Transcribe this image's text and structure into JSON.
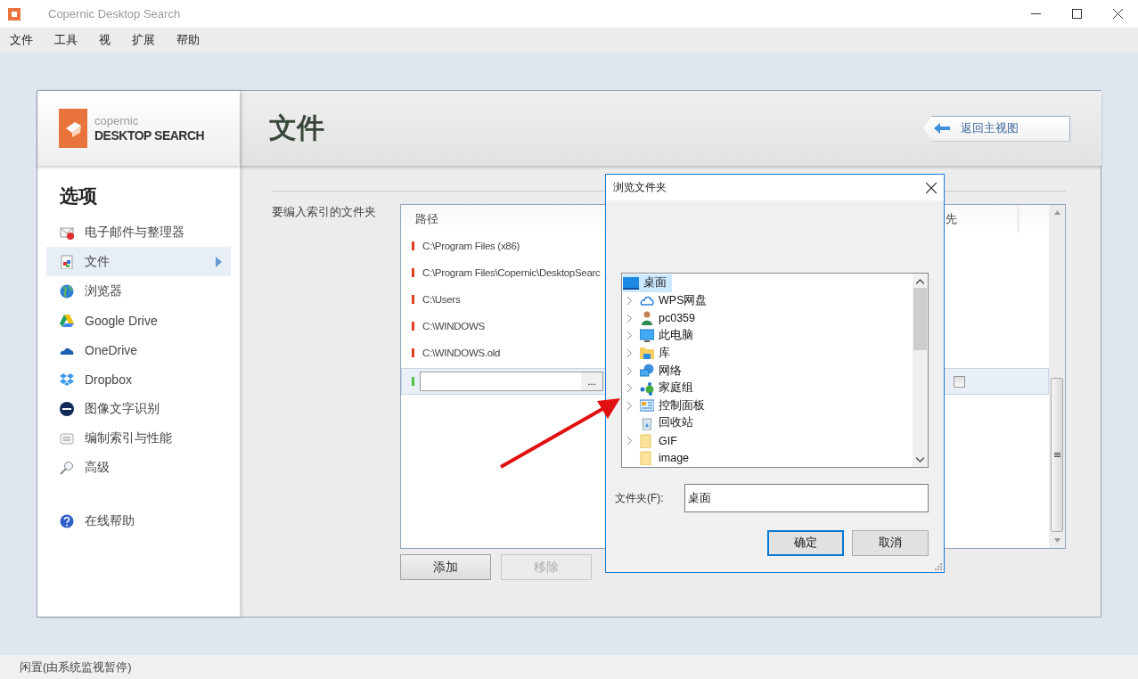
{
  "window": {
    "title": "Copernic Desktop Search"
  },
  "menu": [
    "文件",
    "工具",
    "视",
    "扩展",
    "帮助"
  ],
  "logo": {
    "brand": "copernic",
    "product": "DESKTOP SEARCH"
  },
  "sidebar": {
    "heading": "选项",
    "items": [
      {
        "label": "电子邮件与整理器",
        "selected": false
      },
      {
        "label": "文件",
        "selected": true
      },
      {
        "label": "浏览器",
        "selected": false
      },
      {
        "label": "Google Drive",
        "selected": false
      },
      {
        "label": "OneDrive",
        "selected": false
      },
      {
        "label": "Dropbox",
        "selected": false
      },
      {
        "label": "图像文字识别",
        "selected": false
      },
      {
        "label": "编制索引与性能",
        "selected": false
      },
      {
        "label": "高级",
        "selected": false
      }
    ],
    "help": "在线帮助"
  },
  "page_title": "文件",
  "back_button": "返回主视图",
  "section_label": "要编入索引的文件夹",
  "table": {
    "columns": [
      "路径",
      "先"
    ],
    "rows": [
      {
        "path": "C:\\Program Files (x86)",
        "color": "#e04020"
      },
      {
        "path": "C:\\Program Files\\Copernic\\DesktopSearc",
        "color": "#e04020"
      },
      {
        "path": "C:\\Users",
        "color": "#e04020"
      },
      {
        "path": "C:\\WINDOWS",
        "color": "#e04020"
      },
      {
        "path": "C:\\WINDOWS.old",
        "color": "#e04020"
      }
    ],
    "new_row": {
      "color": "#50c040",
      "browse": "...",
      "checked": false,
      "selected": true
    }
  },
  "buttons": [
    {
      "label": "添加",
      "disabled": false
    },
    {
      "label": "移除",
      "disabled": true
    }
  ],
  "dialog": {
    "title": "浏览文件夹",
    "tree": {
      "label": "桌面",
      "selected": true,
      "children": [
        {
          "label": "WPS网盘",
          "expandable": true
        },
        {
          "label": "pc0359",
          "expandable": true
        },
        {
          "label": "此电脑",
          "expandable": true
        },
        {
          "label": "库",
          "expandable": true
        },
        {
          "label": "网络",
          "expandable": true
        },
        {
          "label": "家庭组",
          "expandable": true
        },
        {
          "label": "控制面板",
          "expandable": true
        },
        {
          "label": "回收站",
          "expandable": false
        },
        {
          "label": "GIF",
          "expandable": true
        },
        {
          "label": "image",
          "expandable": false
        }
      ]
    },
    "folder_label": "文件夹(F):",
    "folder_value": "桌面",
    "buttons": [
      {
        "label": "确定",
        "default": true
      },
      {
        "label": "取消",
        "default": false
      }
    ]
  },
  "status_bar": "闲置(由系统监视暂停)"
}
